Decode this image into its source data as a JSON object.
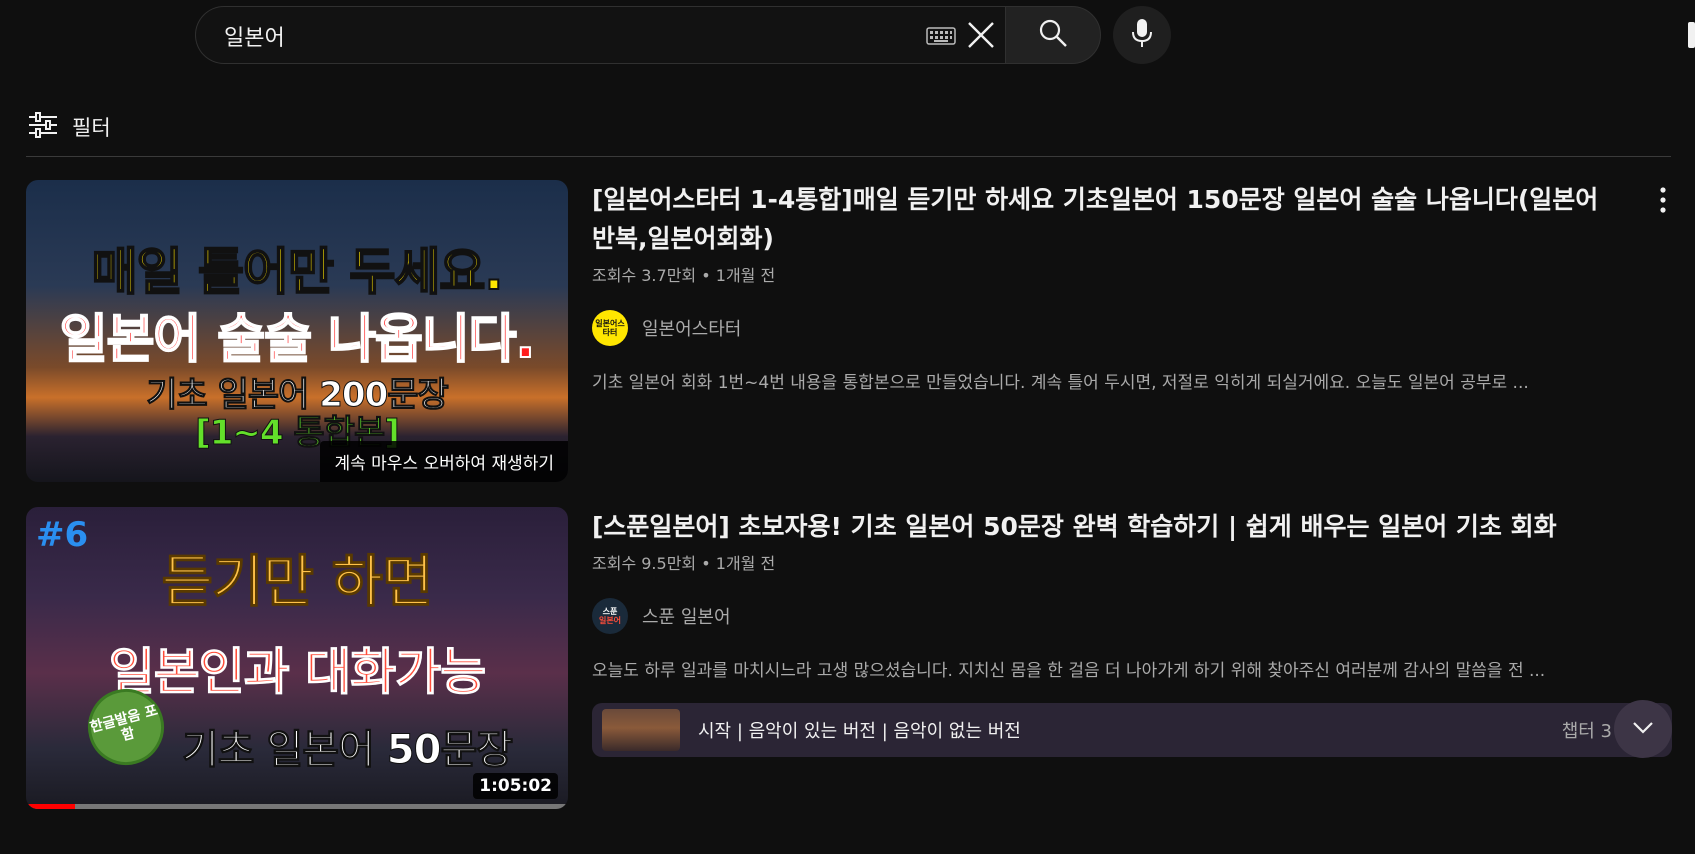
{
  "search": {
    "query": "일본어"
  },
  "filter": {
    "label": "필터"
  },
  "results": [
    {
      "title": "[일본어스타터 1-4통합]매일 듣기만 하세요 기초일본어 150문장 일본어 술술 나옵니다(일본어반복,일본어회화)",
      "views": "조회수 3.7만회",
      "age": "1개월 전",
      "channel": "일본어스타터",
      "avatar_text": "일본어스타터",
      "description": "기초 일본어 회화 1번~4번 내용을 통합본으로 만들었습니다. 계속 틀어 두시면, 저절로 익히게 되실거에요. 오늘도 일본어 공부로 ...",
      "thumbnail": {
        "line1": "매일 틀어만 두세요.",
        "line2": "일본어 술술 나옵니다.",
        "line3": "기초 일본어 200문장",
        "line4": "[1~4 통합본]",
        "hover_hint": "계속 마우스 오버하여 재생하기"
      }
    },
    {
      "title": "[스푼일본어] 초보자용! 기초 일본어 50문장 완벽 학습하기 | 쉽게 배우는 일본어 기초 회화",
      "views": "조회수 9.5만회",
      "age": "1개월 전",
      "channel": "스푼 일본어",
      "avatar_top": "스푼",
      "avatar_bottom": "일본어",
      "description": "오늘도 하루 일과를 마치시느라 고생 많으셨습니다. 지치신 몸을 한 걸음 더 나아가게 하기 위해 찾아주신 여러분께 감사의 말씀을 전 ...",
      "thumbnail": {
        "number": "#6",
        "line1": "듣기만 하면",
        "line2": "일본인과 대화가능",
        "line3": "기초 일본어 50문장",
        "badge": "한글발음 포함",
        "duration": "1:05:02",
        "watched_fraction": 0.09
      },
      "chapters": {
        "text": "시작 | 음악이 있는 버전 | 음악이 없는 버전",
        "count": "챕터 3"
      }
    }
  ],
  "colors": {
    "background": "#0f0f0f",
    "progress": "#ff0000",
    "chapter_bg": "#2b2535"
  }
}
